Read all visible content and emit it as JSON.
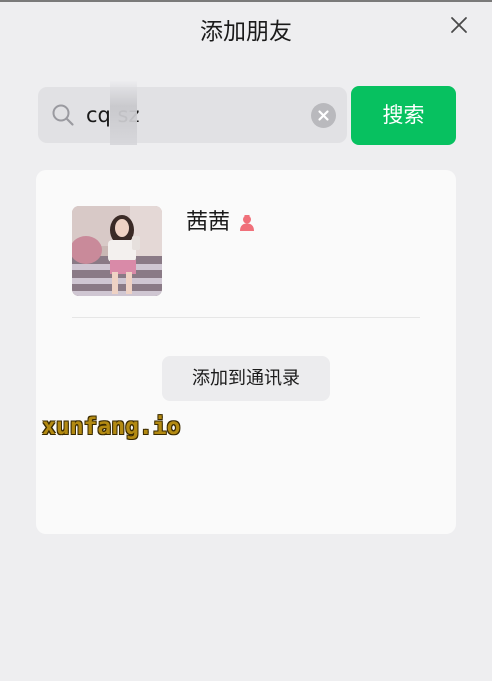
{
  "window": {
    "title": "添加朋友"
  },
  "search": {
    "query": "cq sz",
    "placeholder": ""
  },
  "actions": {
    "search_label": "搜索",
    "add_contact_label": "添加到通讯录"
  },
  "result": {
    "nickname": "茜茜",
    "gender": "female"
  },
  "watermark": {
    "text": "xunfang.io"
  },
  "colors": {
    "accent": "#07c160",
    "background": "#eeeef0",
    "card": "#fafafa",
    "female_icon": "#f0707a",
    "watermark": "#b38a12"
  },
  "icons": {
    "close": "close-icon",
    "search": "search-icon",
    "clear": "clear-icon",
    "gender": "female-icon"
  }
}
